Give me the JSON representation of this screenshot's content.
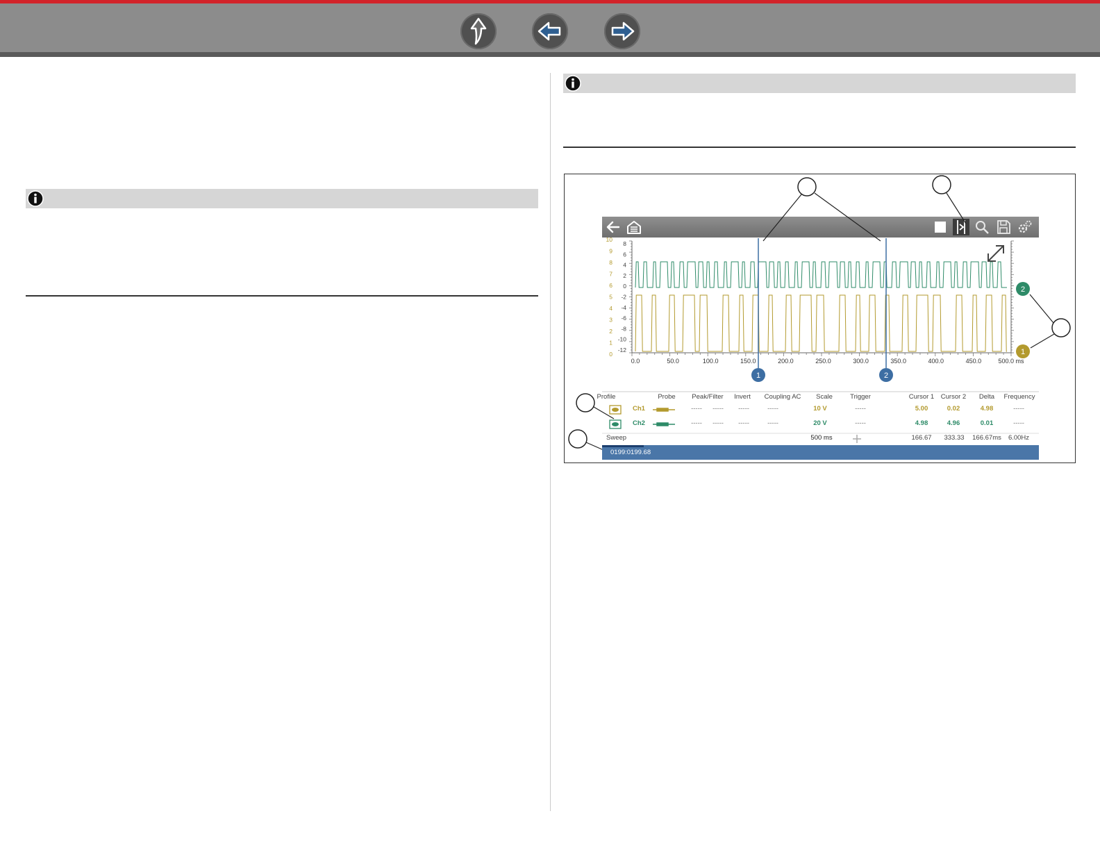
{
  "toolbar": {
    "buttons": [
      {
        "name": "up-arrow-icon"
      },
      {
        "name": "back-arrow-icon"
      },
      {
        "name": "forward-arrow-icon"
      }
    ]
  },
  "colors": {
    "brand_red": "#d2232a",
    "toolbar_gray": "#8c8c8c",
    "note_gray": "#d6d6d6",
    "ch1_yellow": "#b39a2e",
    "ch2_green": "#2e8b68",
    "cursor_blue": "#3d6ea3"
  },
  "scope": {
    "toolbar_icons": [
      "back-icon",
      "home-icon",
      "stop-icon",
      "cursor-icon",
      "zoom-icon",
      "save-icon",
      "settings-icon"
    ],
    "y_ticks_green": [
      "8",
      "6",
      "4",
      "2",
      "0",
      "-2",
      "-4",
      "-6",
      "-8",
      "-10",
      "-12"
    ],
    "y_ticks_yellow": [
      "10",
      "9",
      "8",
      "7",
      "6",
      "5",
      "4",
      "3",
      "2",
      "1",
      "0"
    ],
    "x_ticks": [
      "0.0",
      "50.0",
      "100.0",
      "150.0",
      "200.0",
      "250.0",
      "300.0",
      "350.0",
      "400.0",
      "450.0",
      "500.0 ms"
    ],
    "cursor_labels": [
      "1",
      "2"
    ],
    "channel_markers": [
      "2",
      "1"
    ],
    "table": {
      "headers": [
        "Profile",
        "Probe",
        "Peak/Filter",
        "Invert",
        "Coupling AC",
        "Scale",
        "Trigger",
        "Cursor 1",
        "Cursor 2",
        "Delta",
        "Frequency"
      ],
      "ch1": {
        "name": "Ch1",
        "peak": "-----",
        "filter": "-----",
        "invert": "-----",
        "coupling": "-----",
        "scale": "10 V",
        "trigger": "-----",
        "cursor1": "5.00",
        "cursor2": "0.02",
        "delta": "4.98",
        "frequency": "-----"
      },
      "ch2": {
        "name": "Ch2",
        "peak": "-----",
        "filter": "-----",
        "invert": "-----",
        "coupling": "-----",
        "scale": "20 V",
        "trigger": "-----",
        "cursor1": "4.98",
        "cursor2": "4.96",
        "delta": "0.01",
        "frequency": "-----"
      },
      "sweep": {
        "label": "Sweep",
        "value": "500 ms",
        "cursor1": "166.67",
        "cursor2": "333.33",
        "delta": "166.67ms",
        "frequency": "6.00Hz"
      }
    },
    "status_text": "0199:0199.68"
  }
}
